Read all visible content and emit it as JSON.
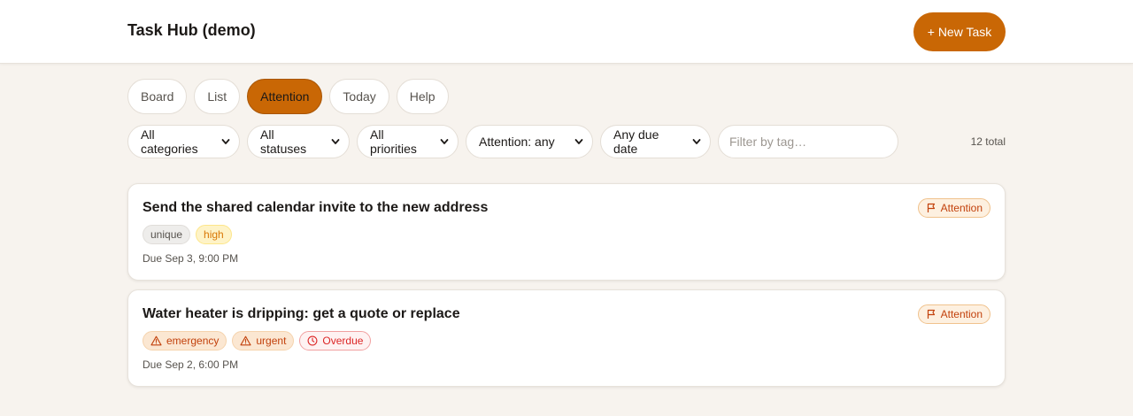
{
  "header": {
    "app_title": "Task Hub (demo)",
    "new_task_label": "+ New Task"
  },
  "tabs": [
    {
      "label": "Board",
      "active": false
    },
    {
      "label": "List",
      "active": false
    },
    {
      "label": "Attention",
      "active": true
    },
    {
      "label": "Today",
      "active": false
    },
    {
      "label": "Help",
      "active": false
    }
  ],
  "filters": {
    "category": "All categories",
    "status": "All statuses",
    "priority": "All priorities",
    "attention": "Attention: any",
    "due": "Any due date",
    "tag_placeholder": "Filter by tag…",
    "total": "12 total"
  },
  "tasks": [
    {
      "title": "Send the shared calendar invite to the new address",
      "badge": "Attention",
      "chips": [
        {
          "label": "unique",
          "style": "neutral",
          "icon": ""
        },
        {
          "label": "high",
          "style": "high",
          "icon": ""
        }
      ],
      "due": "Due Sep 3, 9:00 PM"
    },
    {
      "title": "Water heater is dripping: get a quote or replace",
      "badge": "Attention",
      "chips": [
        {
          "label": "emergency",
          "style": "orange",
          "icon": "warning-icon"
        },
        {
          "label": "urgent",
          "style": "orange",
          "icon": "warning-icon"
        },
        {
          "label": "Overdue",
          "style": "red",
          "icon": "clock-icon"
        }
      ],
      "due": "Due Sep 2, 6:00 PM"
    }
  ],
  "colors": {
    "accent": "#c96705",
    "background": "#f7f3ee",
    "attention": "#c2410c",
    "overdue": "#dc2626"
  }
}
